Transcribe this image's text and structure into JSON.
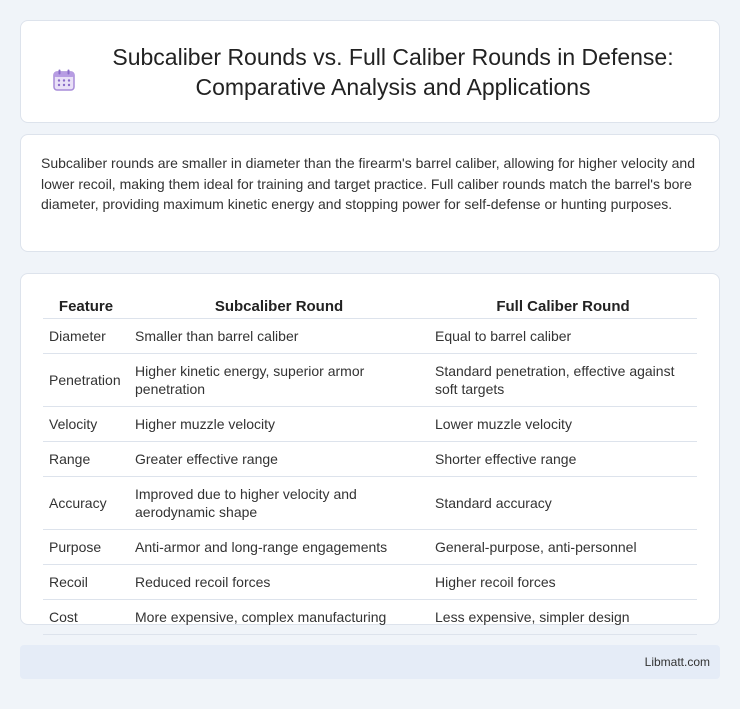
{
  "header": {
    "title": "Subcaliber Rounds vs. Full Caliber Rounds in Defense: Comparative Analysis and Applications",
    "icon": "calendar-icon"
  },
  "intro": {
    "text": "Subcaliber rounds are smaller in diameter than the firearm's barrel caliber, allowing for higher velocity and lower recoil, making them ideal for training and target practice. Full caliber rounds match the barrel's bore diameter, providing maximum kinetic energy and stopping power for self-defense or hunting purposes."
  },
  "table": {
    "headers": [
      "Feature",
      "Subcaliber Round",
      "Full Caliber Round"
    ],
    "rows": [
      [
        "Diameter",
        "Smaller than barrel caliber",
        "Equal to barrel caliber"
      ],
      [
        "Penetration",
        "Higher kinetic energy, superior armor penetration",
        "Standard penetration, effective against soft targets"
      ],
      [
        "Velocity",
        "Higher muzzle velocity",
        "Lower muzzle velocity"
      ],
      [
        "Range",
        "Greater effective range",
        "Shorter effective range"
      ],
      [
        "Accuracy",
        "Improved due to higher velocity and aerodynamic shape",
        "Standard accuracy"
      ],
      [
        "Purpose",
        "Anti-armor and long-range engagements",
        "General-purpose, anti-personnel"
      ],
      [
        "Recoil",
        "Reduced recoil forces",
        "Higher recoil forces"
      ],
      [
        "Cost",
        "More expensive, complex manufacturing",
        "Less expensive, simpler design"
      ]
    ]
  },
  "footer": {
    "brand": "Libmatt.com"
  },
  "colors": {
    "background": "#f0f4f9",
    "card": "#ffffff",
    "footer": "#e5ecf7",
    "icon_accent": "#a78bd8"
  }
}
